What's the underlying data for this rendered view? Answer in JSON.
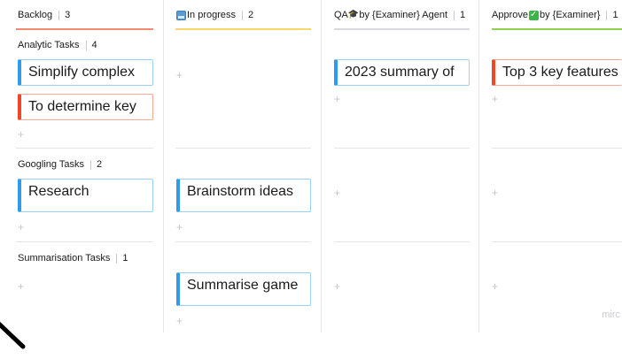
{
  "columns": [
    {
      "title": "Backlog",
      "count": "3",
      "underline_color": "#f28b72"
    },
    {
      "title_prefix_icon": "inbox-icon",
      "title": "In progress",
      "count": "2",
      "underline_color": "#f7d66a"
    },
    {
      "title_pre": "QA",
      "title_icon": "graduate-icon",
      "title_post": " by {Examiner} Agent",
      "count": "1",
      "underline_color": "#d9d9de"
    },
    {
      "title_pre": "Approve",
      "title_icon": "check-icon",
      "title_post": " by {Examiner}",
      "count": "1",
      "underline_color": "#8fd14f"
    }
  ],
  "groups": [
    {
      "label": "Analytic Tasks",
      "count": "4"
    },
    {
      "label": "Googling Tasks",
      "count": "2"
    },
    {
      "label": "Summarisation Tasks",
      "count": "1"
    }
  ],
  "cards": {
    "simplify": "Simplify complex",
    "determine": "To determine key",
    "research": "Research",
    "brainstorm": "Brainstorm ideas",
    "summarise": "Summarise game",
    "summary2023": "2023 summary of",
    "top3": "Top 3 key features"
  },
  "add_symbol": "+",
  "watermark": "mirc",
  "colors": {
    "card_blue": "#2d9bf0",
    "card_red": "#f24726"
  }
}
